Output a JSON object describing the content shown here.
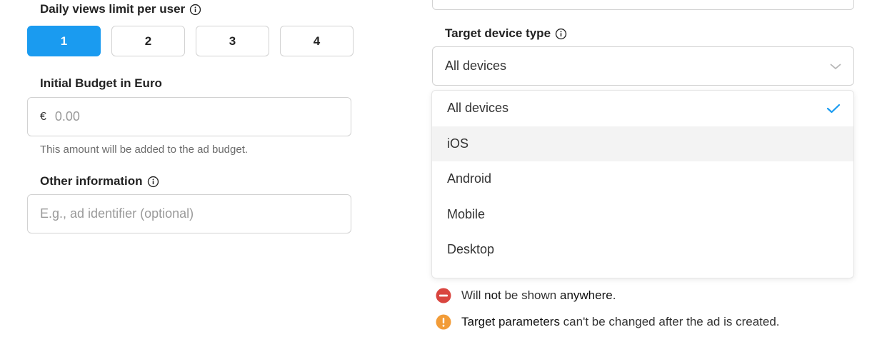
{
  "left": {
    "daily_views": {
      "label": "Daily views limit per user",
      "options": [
        "1",
        "2",
        "3",
        "4"
      ],
      "selected": "1"
    },
    "budget": {
      "label": "Initial Budget in Euro",
      "currency_symbol": "€",
      "placeholder": "0.00",
      "hint": "This amount will be added to the ad budget."
    },
    "other": {
      "label": "Other information",
      "placeholder": "E.g., ad identifier (optional)"
    }
  },
  "right": {
    "device": {
      "label": "Target device type",
      "selected": "All devices",
      "options": [
        "All devices",
        "iOS",
        "Android",
        "Mobile",
        "Desktop"
      ]
    },
    "notices": {
      "warning_pre": "Will ",
      "warning_bold1": "not",
      "warning_mid": " be shown ",
      "warning_bold2": "anywhere",
      "warning_post": ".",
      "info_bold": "Target parameters",
      "info_rest": " can't be changed after the ad is created."
    }
  },
  "colors": {
    "accent": "#1a9bf0",
    "error": "#d9453f",
    "warning": "#f29c38"
  }
}
